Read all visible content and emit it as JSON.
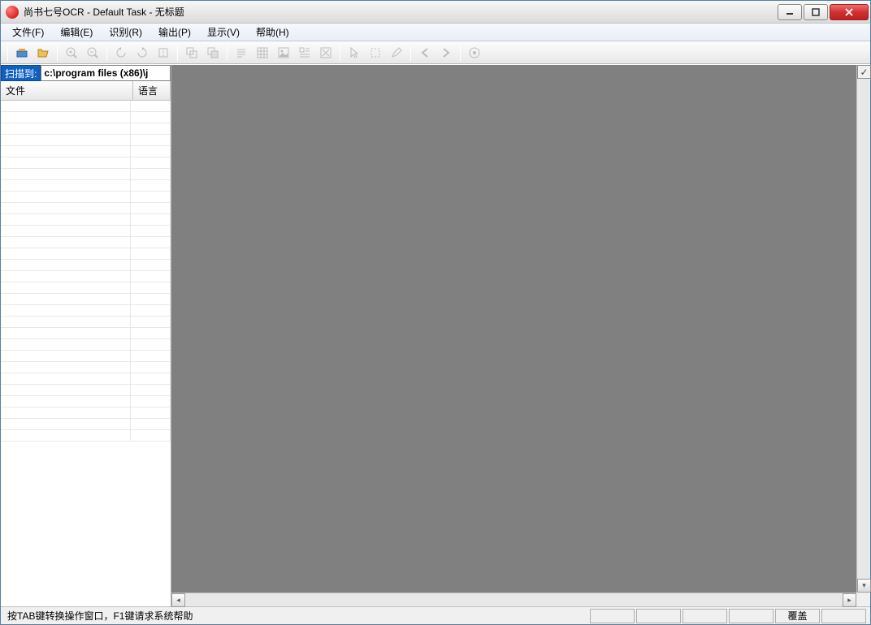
{
  "titlebar": {
    "title": "尚书七号OCR - Default Task - 无标题"
  },
  "menu": {
    "file": "文件(F)",
    "edit": "编辑(E)",
    "recognize": "识别(R)",
    "output": "输出(P)",
    "view": "显示(V)",
    "help": "帮助(H)"
  },
  "sidebar": {
    "scan_label": "扫描到:",
    "scan_path": "c:\\program files (x86)\\j",
    "col_file": "文件",
    "col_lang": "语言"
  },
  "statusbar": {
    "hint": "按TAB键转换操作窗口，F1键请求系统帮助",
    "overwrite": "覆盖"
  }
}
